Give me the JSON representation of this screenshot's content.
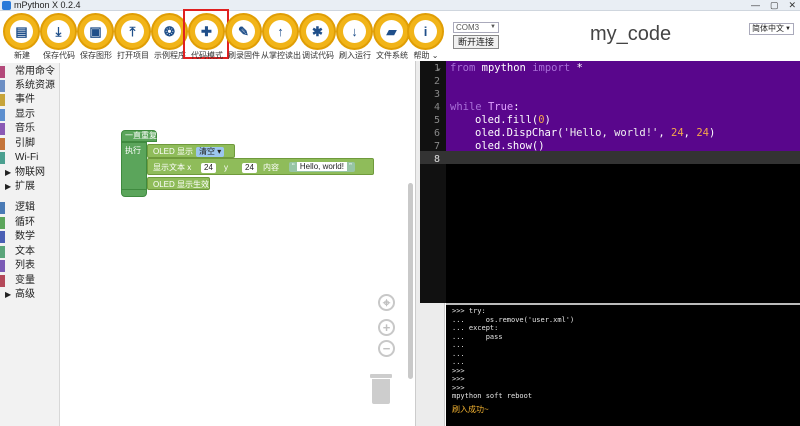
{
  "window": {
    "title": "mPython X 0.2.4",
    "controls": [
      "—",
      "▢",
      "✕"
    ]
  },
  "toolbar": {
    "buttons": [
      {
        "label": "新建",
        "icon": "new-file-icon",
        "glyph": "▤"
      },
      {
        "label": "保存代码",
        "icon": "save-code-icon",
        "glyph": "⤓"
      },
      {
        "label": "保存图形",
        "icon": "save-graphic-icon",
        "glyph": "▣"
      },
      {
        "label": "打开项目",
        "icon": "open-project-icon",
        "glyph": "⤒"
      },
      {
        "label": "示例程序",
        "icon": "examples-icon",
        "glyph": "❂"
      },
      {
        "label": "代码模式",
        "icon": "puzzle-icon",
        "glyph": "✚"
      },
      {
        "label": "刷录固件",
        "icon": "wrench-icon",
        "glyph": "✎"
      },
      {
        "label": "从掌控读出",
        "icon": "upload-icon",
        "glyph": "↑"
      },
      {
        "label": "调试代码",
        "icon": "bug-icon",
        "glyph": "✱"
      },
      {
        "label": "刷入运行",
        "icon": "download-run-icon",
        "glyph": "↓"
      },
      {
        "label": "文件系统",
        "icon": "folder-icon",
        "glyph": "▰"
      },
      {
        "label": "帮助",
        "icon": "info-icon",
        "glyph": "i"
      }
    ],
    "help_arrow": "⌄"
  },
  "connection": {
    "port": "COM3",
    "disconnect_label": "断开连接"
  },
  "project_title": "my_code",
  "language": "简体中文",
  "categories": [
    {
      "label": "常用命令",
      "color": "#b3487a"
    },
    {
      "label": "系统资源",
      "color": "#6d8fc4"
    },
    {
      "label": "事件",
      "color": "#c7a43a"
    },
    {
      "label": "显示",
      "color": "#5d8fcf"
    },
    {
      "label": "音乐",
      "color": "#8b5ab5"
    },
    {
      "label": "引脚",
      "color": "#c4743a"
    },
    {
      "label": "Wi-Fi",
      "color": "#4a9f8f"
    },
    {
      "label": "物联网",
      "color": ""
    },
    {
      "label": "扩展",
      "color": ""
    },
    {
      "label": "逻辑",
      "color": "#4a7ab5"
    },
    {
      "label": "循环",
      "color": "#5ba55b"
    },
    {
      "label": "数学",
      "color": "#4a5fb5"
    },
    {
      "label": "文本",
      "color": "#5aa57a"
    },
    {
      "label": "列表",
      "color": "#7a5ab5"
    },
    {
      "label": "变量",
      "color": "#b5495a"
    },
    {
      "label": "高级",
      "color": ""
    }
  ],
  "blocks": {
    "loop_label": "一直重复",
    "do_label": "执行",
    "oled_show": "OLED 显示",
    "clear_option": "清空",
    "show_text_x": "显示文本 x",
    "x_value": "24",
    "y_label": "y",
    "y_value": "24",
    "content_label": "内容",
    "quote_open": "“",
    "text_value": "Hello, world!",
    "quote_close": "”",
    "oled_apply": "OLED 显示生效"
  },
  "workspace_controls": {
    "center": "⌖",
    "zoom_in": "+",
    "zoom_out": "−"
  },
  "code": {
    "line_numbers": [
      "1",
      "2",
      "3",
      "4",
      "5",
      "6",
      "7",
      "8"
    ],
    "l1_from": "from",
    "l1_mod": "mpython",
    "l1_import": "import",
    "l1_star": "*",
    "l4_while": "while",
    "l4_true": "True",
    "l4_colon": ":",
    "l5": "oled.fill(",
    "l5_num": "0",
    "l5_end": ")",
    "l6_a": "oled.DispChar(",
    "l6_str": "'Hello, world!'",
    "l6_b": ", ",
    "l6_n1": "24",
    "l6_c": ", ",
    "l6_n2": "24",
    "l6_d": ")",
    "l7": "oled.show()"
  },
  "console": {
    "lines": ">>> try:\n...     os.remove('user.xml')\n... except:\n...     pass\n...\n...\n...\n>>>\n>>>\n>>>\nmpython soft reboot",
    "success": "刷入成功~"
  }
}
